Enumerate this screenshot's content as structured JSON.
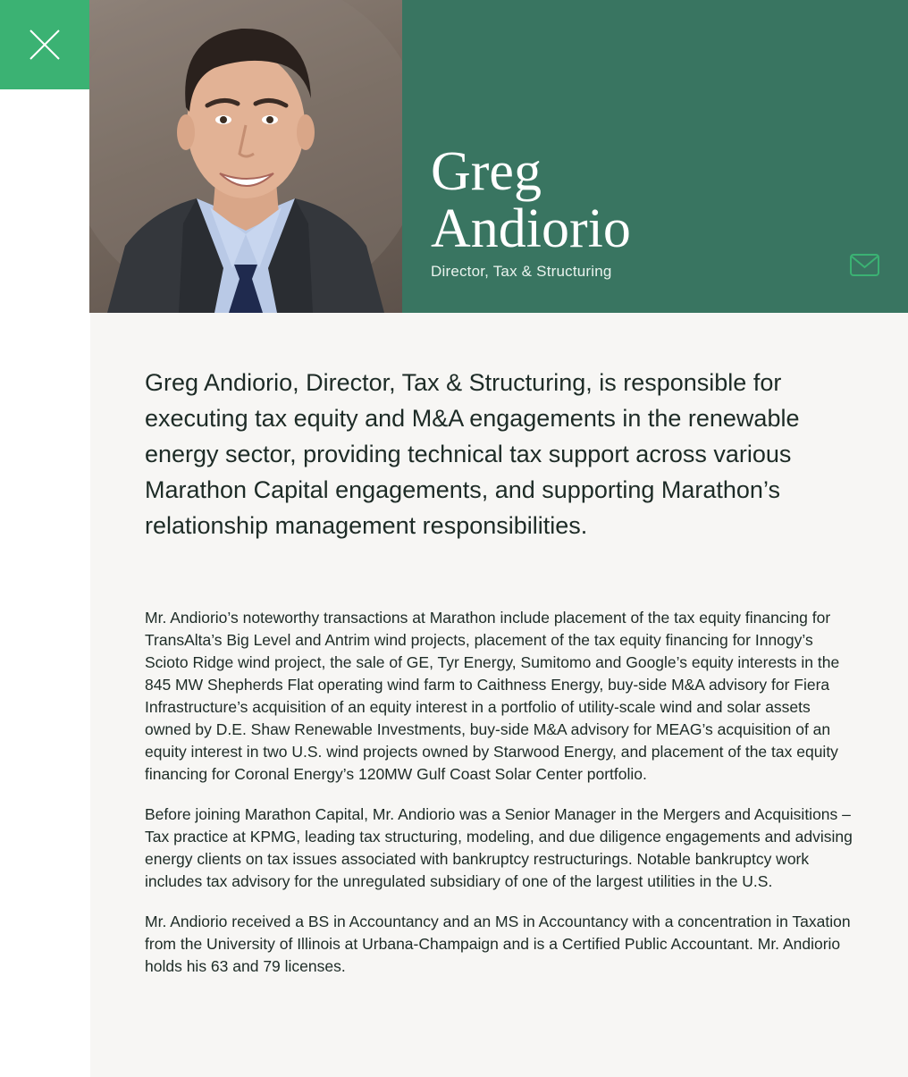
{
  "profile": {
    "first_name": "Greg",
    "last_name": "Andiorio",
    "title": "Director, Tax & Structuring"
  },
  "icons": {
    "close": "close-icon",
    "email": "mail-icon"
  },
  "colors": {
    "close_bg": "#3bb273",
    "header_bg": "#397561",
    "content_bg": "#f7f6f4",
    "text": "#1d2b26"
  },
  "bio": {
    "lead": "Greg Andiorio, Director, Tax & Structuring, is responsible for executing tax equity and M&A engagements in the renewable energy sector, providing technical tax support across various Marathon Capital engagements, and supporting Marathon’s relationship management responsibilities.",
    "paragraphs": [
      "Mr. Andiorio’s noteworthy transactions at Marathon include placement of the tax equity financing for TransAlta’s Big Level and Antrim wind projects, placement of the tax equity financing for Innogy’s Scioto Ridge wind project, the sale of GE, Tyr Energy, Sumitomo and Google’s equity interests in the 845 MW Shepherds Flat operating wind farm to Caithness Energy, buy-side M&A advisory for Fiera Infrastructure’s acquisition of an equity interest in a portfolio of utility-scale wind and solar assets owned by D.E. Shaw Renewable Investments, buy-side M&A advisory for MEAG’s acquisition of an equity interest in two U.S. wind projects owned by Starwood Energy, and placement of the tax equity financing for Coronal Energy’s 120MW Gulf Coast Solar Center portfolio.",
      "Before joining Marathon Capital, Mr. Andiorio was a Senior Manager in the Mergers and Acquisitions – Tax practice at KPMG, leading tax structuring, modeling, and due diligence engagements and advising energy clients on tax issues associated with bankruptcy restructurings. Notable bankruptcy work includes tax advisory for the unregulated subsidiary of one of the largest utilities in the U.S.",
      "Mr. Andiorio received a BS in Accountancy and an MS in Accountancy with a concentration in Taxation from the University of Illinois at Urbana-Champaign and is a Certified Public Accountant. Mr. Andiorio holds his 63 and 79 licenses."
    ]
  }
}
